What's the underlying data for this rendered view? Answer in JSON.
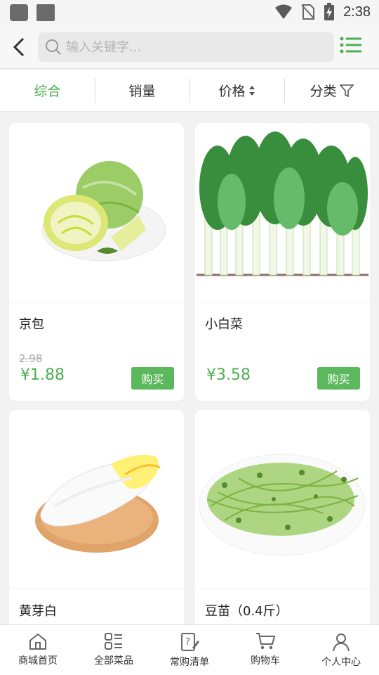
{
  "status_bar": {
    "time": "2:38"
  },
  "search": {
    "placeholder": "输入关键字..."
  },
  "filters": [
    {
      "label": "综合",
      "active": true
    },
    {
      "label": "销量",
      "active": false
    },
    {
      "label": "价格",
      "active": false
    },
    {
      "label": "分类",
      "active": false
    }
  ],
  "products": [
    {
      "name": "京包",
      "old_price": "2.98",
      "price": "¥1.88",
      "buy_label": "购买"
    },
    {
      "name": "小白菜",
      "old_price": "",
      "price": "¥3.58",
      "buy_label": "购买"
    },
    {
      "name": "黄芽白"
    },
    {
      "name": "豆苗（0.4斤）"
    }
  ],
  "bottom_nav": [
    {
      "label": "商城首页",
      "icon": "home-icon"
    },
    {
      "label": "全部菜品",
      "icon": "category-icon"
    },
    {
      "label": "常购清单",
      "icon": "list-edit-icon"
    },
    {
      "label": "购物车",
      "icon": "cart-icon"
    },
    {
      "label": "个人中心",
      "icon": "user-icon"
    }
  ],
  "colors": {
    "accent": "#4caf50",
    "buy_button": "#5cb85c",
    "background": "#f2f2f2"
  }
}
